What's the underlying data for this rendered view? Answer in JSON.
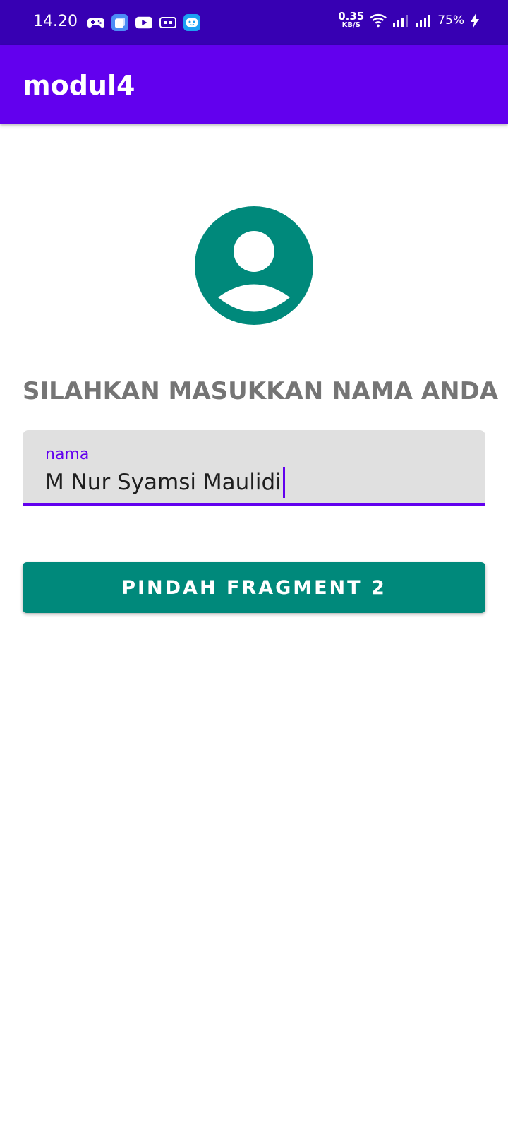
{
  "status_bar": {
    "time": "14.20",
    "left_icons": [
      "gamepad-icon",
      "app-stack-icon",
      "youtube-icon",
      "cassette-icon",
      "robot-face-icon"
    ],
    "net_speed_value": "0.35",
    "net_speed_unit": "KB/S",
    "right_icons": [
      "wifi-icon",
      "signal-icon",
      "signal-icon",
      "charging-icon"
    ],
    "battery": "75%"
  },
  "app_bar": {
    "title": "modul4"
  },
  "main": {
    "avatar_icon": "account-circle-icon",
    "prompt": "SILAHKAN MASUKKAN NAMA ANDA",
    "name_field": {
      "label": "nama",
      "value": "M Nur Syamsi Maulidi"
    },
    "button_label": "PINDAH FRAGMENT 2"
  },
  "colors": {
    "status_bar": "#3700B3",
    "app_bar": "#6200EE",
    "accent": "#00897B",
    "field_bg": "#E0E0E0",
    "prompt_text": "#757575"
  }
}
